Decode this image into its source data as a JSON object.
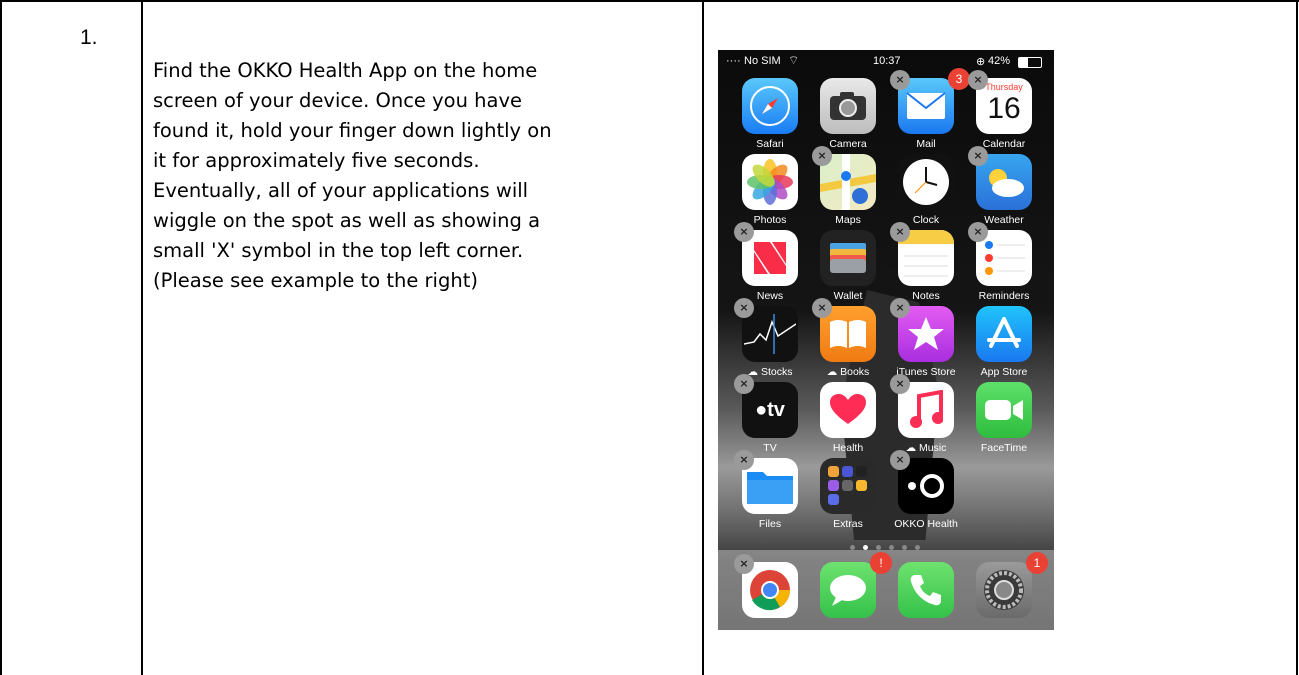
{
  "step_number": "1.",
  "instructions": "Find the OKKO Health App on the home\nscreen of your device. Once you have\nfound it, hold your finger down lightly on\nit for approximately five seconds.\nEventually, all of your applications will\nwiggle on the spot as well as showing a\nsmall 'X' symbol in the top left corner.\n(Please see example to the right)",
  "status_bar": {
    "carrier": "No SIM",
    "time": "10:37",
    "battery": "42%"
  },
  "delete_glyph": "×",
  "calendar": {
    "weekday": "Thursday",
    "day": "16"
  },
  "apps": [
    {
      "label": "Safari",
      "icon": "safari-icon",
      "delete": false
    },
    {
      "label": "Camera",
      "icon": "camera-icon",
      "delete": false
    },
    {
      "label": "Mail",
      "icon": "mail-icon",
      "delete": true,
      "badge": "3"
    },
    {
      "label": "Calendar",
      "icon": "calendar-icon",
      "delete": true
    },
    {
      "label": "Photos",
      "icon": "photos-icon",
      "delete": false
    },
    {
      "label": "Maps",
      "icon": "maps-icon",
      "delete": true
    },
    {
      "label": "Clock",
      "icon": "clock-icon",
      "delete": false
    },
    {
      "label": "Weather",
      "icon": "weather-icon",
      "delete": true
    },
    {
      "label": "News",
      "icon": "news-icon",
      "delete": true
    },
    {
      "label": "Wallet",
      "icon": "wallet-icon",
      "delete": false
    },
    {
      "label": "Notes",
      "icon": "notes-icon",
      "delete": true
    },
    {
      "label": "Reminders",
      "icon": "reminders-icon",
      "delete": true
    },
    {
      "label": "Stocks",
      "icon": "stocks-icon",
      "delete": true,
      "cloud": true
    },
    {
      "label": "Books",
      "icon": "books-icon",
      "delete": true,
      "cloud": true
    },
    {
      "label": "iTunes Store",
      "icon": "itunes-store-icon",
      "delete": true
    },
    {
      "label": "App Store",
      "icon": "app-store-icon",
      "delete": false
    },
    {
      "label": "TV",
      "icon": "tv-icon",
      "delete": true,
      "text": "tv"
    },
    {
      "label": "Health",
      "icon": "health-icon",
      "delete": false
    },
    {
      "label": "Music",
      "icon": "music-icon",
      "delete": true,
      "cloud": true
    },
    {
      "label": "FaceTime",
      "icon": "facetime-icon",
      "delete": false
    },
    {
      "label": "Files",
      "icon": "files-icon",
      "delete": true
    },
    {
      "label": "Extras",
      "icon": "extras-folder-icon",
      "delete": false
    },
    {
      "label": "OKKO Health",
      "icon": "okko-health-icon",
      "delete": true
    }
  ],
  "dock": [
    {
      "icon": "chrome-icon",
      "delete": true
    },
    {
      "icon": "messages-icon",
      "delete": false,
      "badge": "!"
    },
    {
      "icon": "phone-icon",
      "delete": false
    },
    {
      "icon": "settings-icon",
      "delete": false,
      "badge": "1"
    }
  ],
  "colors": {
    "border": "#000000",
    "badge": "#e94134",
    "delete_badge": "#9a9a9a"
  }
}
